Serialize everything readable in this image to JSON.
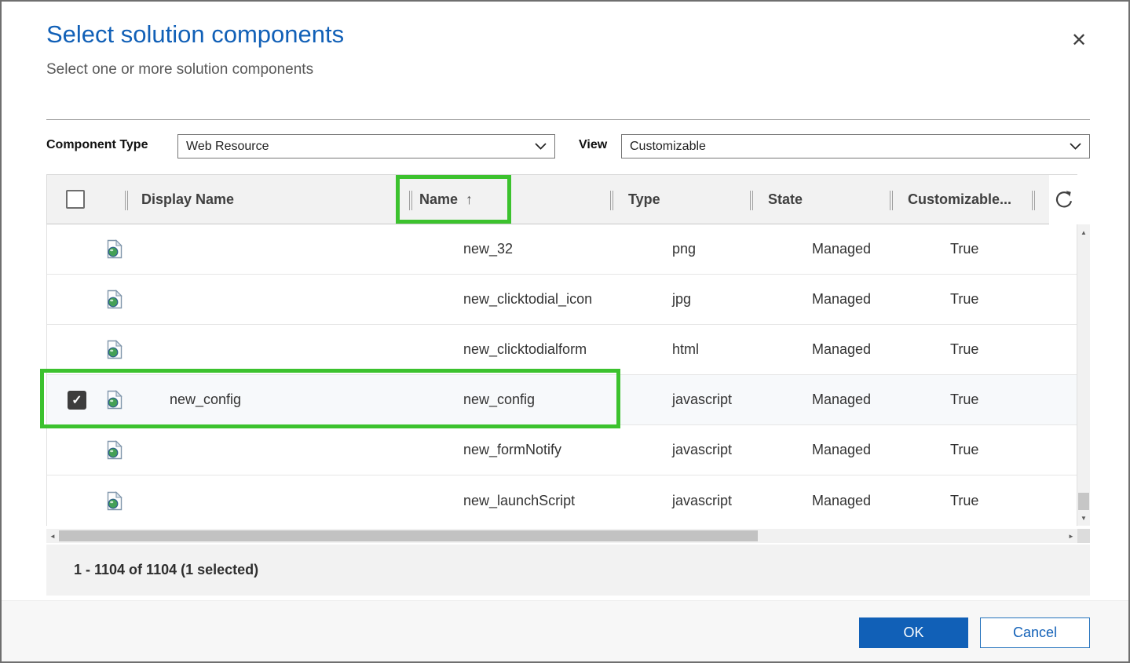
{
  "dialog": {
    "title": "Select solution components",
    "subtitle": "Select one or more solution components"
  },
  "icons": {
    "close": "✕",
    "check": "✓",
    "sort_asc": "↑",
    "scroll_up": "▲",
    "scroll_down": "▼",
    "scroll_left": "◄",
    "scroll_right": "►"
  },
  "filters": {
    "component_type_label": "Component Type",
    "component_type_value": "Web Resource",
    "view_label": "View",
    "view_value": "Customizable"
  },
  "table": {
    "columns": {
      "display_name": "Display Name",
      "name": "Name",
      "type": "Type",
      "state": "State",
      "customizable": "Customizable..."
    },
    "sort": {
      "column": "Name",
      "direction": "ascending"
    },
    "rows": [
      {
        "checked": false,
        "display_name": "",
        "name": "new_32",
        "type": "png",
        "state": "Managed",
        "customizable": "True"
      },
      {
        "checked": false,
        "display_name": "",
        "name": "new_clicktodial_icon",
        "type": "jpg",
        "state": "Managed",
        "customizable": "True"
      },
      {
        "checked": false,
        "display_name": "",
        "name": "new_clicktodialform",
        "type": "html",
        "state": "Managed",
        "customizable": "True"
      },
      {
        "checked": true,
        "display_name": "new_config",
        "name": "new_config",
        "type": "javascript",
        "state": "Managed",
        "customizable": "True"
      },
      {
        "checked": false,
        "display_name": "",
        "name": "new_formNotify",
        "type": "javascript",
        "state": "Managed",
        "customizable": "True"
      },
      {
        "checked": false,
        "display_name": "",
        "name": "new_launchScript",
        "type": "javascript",
        "state": "Managed",
        "customizable": "True"
      }
    ]
  },
  "footer": {
    "record_count": "1 - 1104 of 1104 (1 selected)"
  },
  "actions": {
    "ok_label": "OK",
    "cancel_label": "Cancel"
  },
  "colors": {
    "accent_blue": "#1160b7",
    "annotation_green": "#3cc22e",
    "header_bg": "#f2f2f2",
    "checked_checkbox": "#3d3d3d"
  }
}
